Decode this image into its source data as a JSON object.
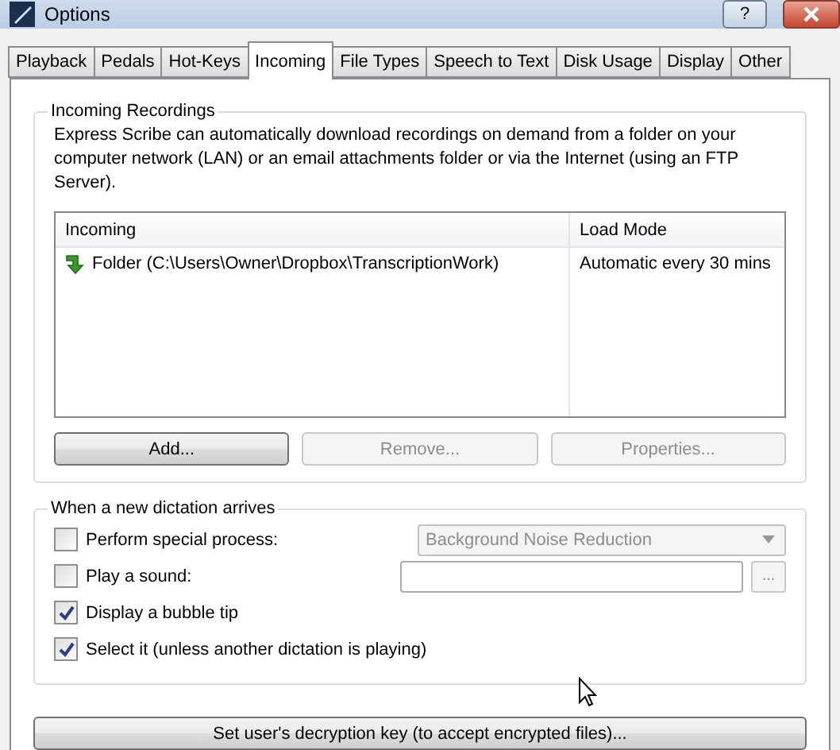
{
  "window": {
    "title": "Options",
    "help_label": "?"
  },
  "tabs": [
    {
      "label": "Playback",
      "selected": false
    },
    {
      "label": "Pedals",
      "selected": false
    },
    {
      "label": "Hot-Keys",
      "selected": false
    },
    {
      "label": "Incoming",
      "selected": true
    },
    {
      "label": "File Types",
      "selected": false
    },
    {
      "label": "Speech to Text",
      "selected": false
    },
    {
      "label": "Disk Usage",
      "selected": false
    },
    {
      "label": "Display",
      "selected": false
    },
    {
      "label": "Other",
      "selected": false
    }
  ],
  "incoming_group": {
    "title": "Incoming Recordings",
    "description": "Express Scribe can automatically download recordings on demand from a folder on your computer network (LAN) or an email attachments folder or via the Internet (using an FTP Server).",
    "columns": [
      "Incoming",
      "Load Mode"
    ],
    "rows": [
      {
        "source": "Folder (C:\\Users\\Owner\\Dropbox\\TranscriptionWork)",
        "load_mode": "Automatic every 30 mins"
      }
    ],
    "buttons": [
      {
        "label": "Add...",
        "disabled": false
      },
      {
        "label": "Remove...",
        "disabled": true
      },
      {
        "label": "Properties...",
        "disabled": true
      }
    ]
  },
  "dictation_group": {
    "title": "When a new dictation arrives",
    "options": [
      {
        "kind": "dropdown",
        "label": "Perform special process:",
        "checked": false,
        "value": "Background Noise Reduction",
        "disabled": true
      },
      {
        "kind": "file",
        "label": "Play a sound:",
        "checked": false,
        "browse_label": "..."
      },
      {
        "kind": "plain",
        "label": "Display a bubble tip",
        "checked": true
      },
      {
        "kind": "plain",
        "label": "Select it (unless another dictation is playing)",
        "checked": true
      }
    ]
  },
  "bottom_button": {
    "label": "Set user's decryption key (to accept encrypted files)..."
  }
}
